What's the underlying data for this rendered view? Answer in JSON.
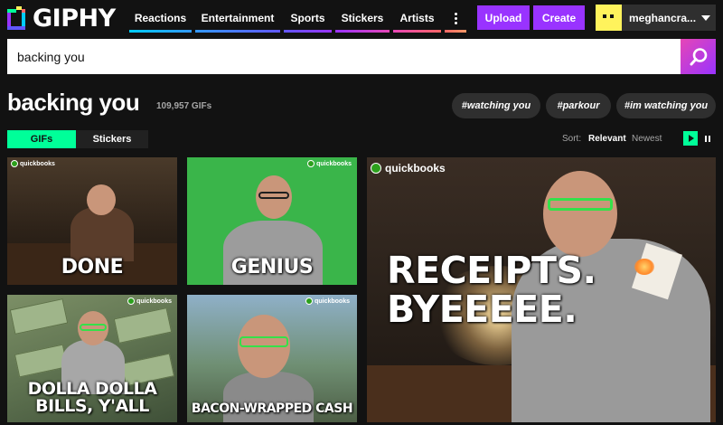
{
  "header": {
    "logo_text": "GIPHY",
    "nav": [
      {
        "label": "Reactions"
      },
      {
        "label": "Entertainment"
      },
      {
        "label": "Sports"
      },
      {
        "label": "Stickers"
      },
      {
        "label": "Artists"
      }
    ],
    "upload_label": "Upload",
    "create_label": "Create",
    "username": "meghancra..."
  },
  "search": {
    "value": "backing you"
  },
  "results": {
    "title": "backing you",
    "count": "109,957 GIFs",
    "tags": [
      "#watching you",
      "#parkour",
      "#im watching you"
    ]
  },
  "toggle": {
    "gifs_label": "GIFs",
    "stickers_label": "Stickers"
  },
  "sort": {
    "label": "Sort:",
    "relevant": "Relevant",
    "newest": "Newest"
  },
  "gifs": [
    {
      "caption": "DONE",
      "watermark": "quickbooks"
    },
    {
      "caption": "GENIUS",
      "watermark": "quickbooks"
    },
    {
      "caption": "DOLLA DOLLA BILLS, Y'ALL",
      "watermark": "quickbooks"
    },
    {
      "caption": "BACON-WRAPPED CASH",
      "watermark": "quickbooks"
    },
    {
      "caption": "RECEIPTS. BYEEEEE.",
      "watermark": "quickbooks"
    }
  ],
  "colors": {
    "background": "#121212",
    "accent_purple": "#9933ff",
    "accent_green": "#00ff99",
    "search_button": "#e646b6"
  },
  "icons": {
    "search": "search-icon",
    "more": "more-dots-icon",
    "dropdown": "chevron-down-icon",
    "play": "play-icon",
    "pause": "pause-icon"
  }
}
